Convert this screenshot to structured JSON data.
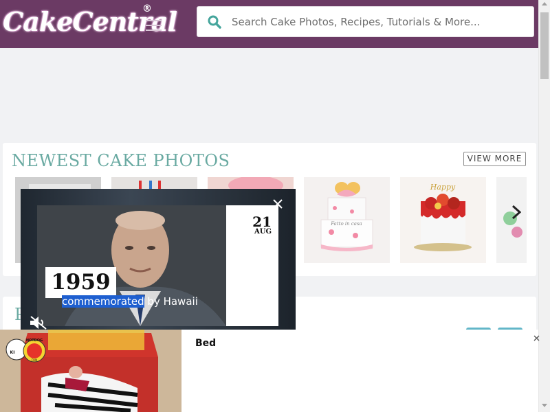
{
  "header": {
    "logo_text": "CakeCentral",
    "logo_reg": "®",
    "menu_icon": "hamburger-menu-icon",
    "search": {
      "placeholder": "Search Cake Photos, Recipes, Tutorials & More...",
      "value": "",
      "icon": "search-icon"
    }
  },
  "newest": {
    "title": "NEWEST CAKE PHOTOS",
    "view_more": "VIEW MORE",
    "next_icon": "chevron-right-icon",
    "thumbs": [
      {
        "name": "cake-thumb-1"
      },
      {
        "name": "cake-thumb-2"
      },
      {
        "name": "cake-thumb-3"
      },
      {
        "name": "cake-thumb-4-pink-bow-cake"
      },
      {
        "name": "cake-thumb-5-red-drip-cake"
      },
      {
        "name": "cake-thumb-6"
      }
    ]
  },
  "section2": {
    "title_initial": "P"
  },
  "video": {
    "day": "21",
    "month": "AUG",
    "year": "1959",
    "caption_highlight": "commemorated",
    "caption_rest": " by Hawaii",
    "close_icon": "close-icon",
    "mute_icon": "mute-icon"
  },
  "ad": {
    "title": "Bed",
    "close_icon": "close-icon",
    "badge_text": "KI HOTDOG FUN"
  },
  "colors": {
    "header_bg": "#6b3a64",
    "accent_teal": "#6aaaa2",
    "search_icon": "#45a59c",
    "highlight": "#1e5fd0"
  }
}
